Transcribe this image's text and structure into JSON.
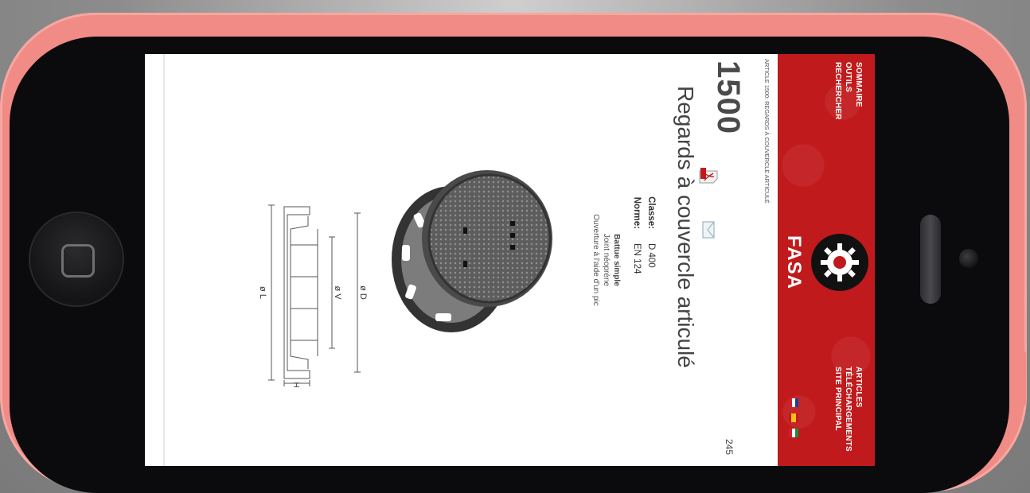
{
  "nav": {
    "left": [
      "SOMMAIRE",
      "OUTILS",
      "RECHERCHER"
    ],
    "right": [
      "ARTICLES",
      "TÉLÉCHARGEMENTS",
      "SITE PRINCIPAL"
    ]
  },
  "logo": {
    "name": "FASA"
  },
  "languages": [
    "fr-flag-icon",
    "es-flag-icon",
    "it-flag-icon"
  ],
  "breadcrumb": "ARTICLE 1500: REGARDS À COUVERCLE ARTICULÉ",
  "page_number": "245",
  "article": {
    "number": "1500",
    "title": "Regards à couvercle articulé",
    "specs": [
      {
        "label": "Classe:",
        "value": "D 400"
      },
      {
        "label": "Norme:",
        "value": "EN 124"
      }
    ],
    "features": [
      "Battue simple",
      "Joint néoprène",
      "Ouverture à l'aide d'un pic"
    ]
  },
  "drawing": {
    "labels": {
      "d": "ø D",
      "v": "ø V",
      "l": "ø L",
      "h": "H"
    }
  },
  "colors": {
    "header_red": "#c11a1c",
    "phone_pink": "#f08b86"
  }
}
